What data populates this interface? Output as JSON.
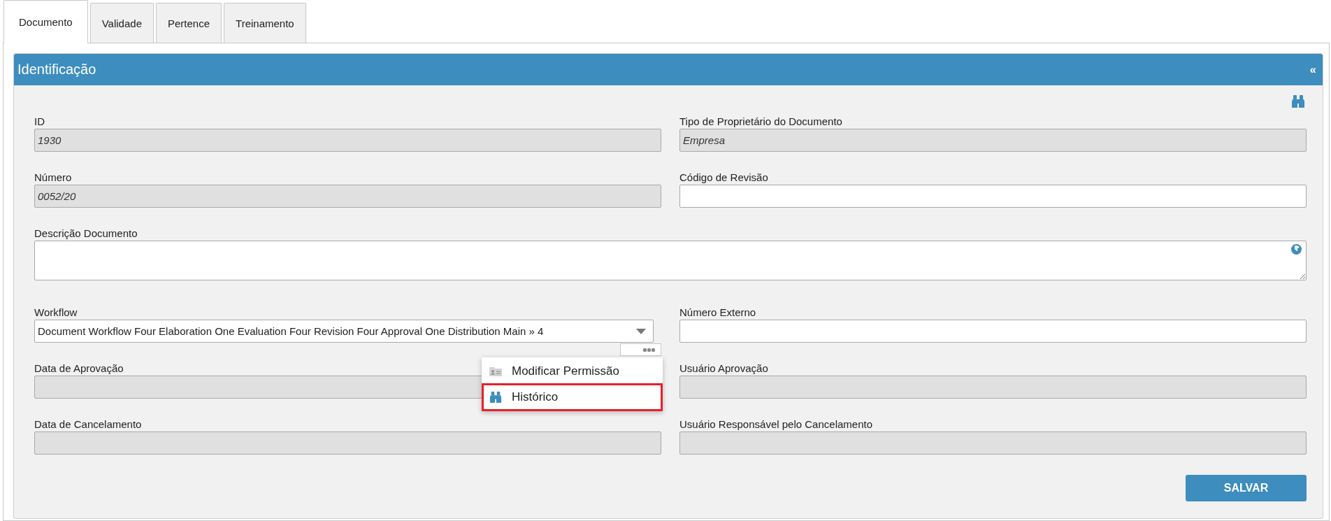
{
  "tabs": [
    {
      "label": "Documento",
      "selected": true
    },
    {
      "label": "Validade",
      "selected": false
    },
    {
      "label": "Pertence",
      "selected": false
    },
    {
      "label": "Treinamento",
      "selected": false
    }
  ],
  "panel": {
    "title": "Identificação",
    "collapse_toggle": "«"
  },
  "fields": [
    {
      "label": "ID",
      "kind": "text",
      "value": "1930",
      "readonly": true
    },
    {
      "label": "Tipo de Proprietário do Documento",
      "kind": "text",
      "value": "Empresa",
      "readonly": true
    },
    {
      "label": "Número",
      "kind": "text",
      "value": "0052/20",
      "readonly": true
    },
    {
      "label": "Código de Revisão",
      "kind": "text",
      "readonly": false
    },
    {
      "label": "Descrição Documento",
      "kind": "textarea",
      "readonly": false
    },
    {
      "label": "Workflow",
      "kind": "select",
      "value": "Document Workflow Four Elaboration One Evaluation Four Revision Four Approval One Distribution Main » 4",
      "readonly": false
    },
    {
      "label": "Número Externo",
      "kind": "text",
      "readonly": false
    },
    {
      "label": "Data de Aprovação",
      "kind": "text",
      "readonly": true
    },
    {
      "label": "Usuário Aprovação",
      "kind": "text",
      "readonly": true
    },
    {
      "label": "Data de Cancelamento",
      "kind": "text",
      "readonly": true
    },
    {
      "label": "Usuário Responsável pelo Cancelamento",
      "kind": "text",
      "readonly": true
    }
  ],
  "context_menu": {
    "items": [
      {
        "label": "Modificar Permissão",
        "selected": false
      },
      {
        "label": "Histórico",
        "selected": true
      }
    ]
  },
  "save_button": "SALVAR"
}
